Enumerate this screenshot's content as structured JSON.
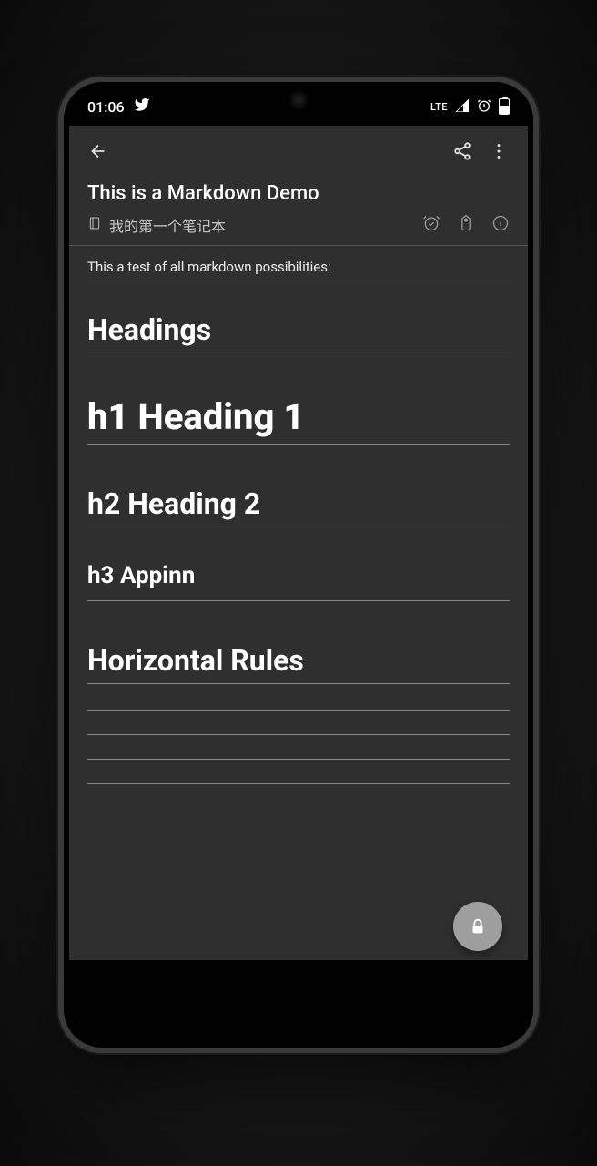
{
  "status": {
    "time": "01:06",
    "network": "LTE"
  },
  "appbar": {},
  "note": {
    "title": "This is a Markdown Demo",
    "notebook": "我的第一个笔记本"
  },
  "content": {
    "intro": "This a test of all markdown possibilities:",
    "headings_label": "Headings",
    "h1_text": "h1 Heading 1",
    "h2_text": "h2 Heading 2",
    "h3_text": "h3 Appinn",
    "hr_label": "Horizontal Rules"
  }
}
